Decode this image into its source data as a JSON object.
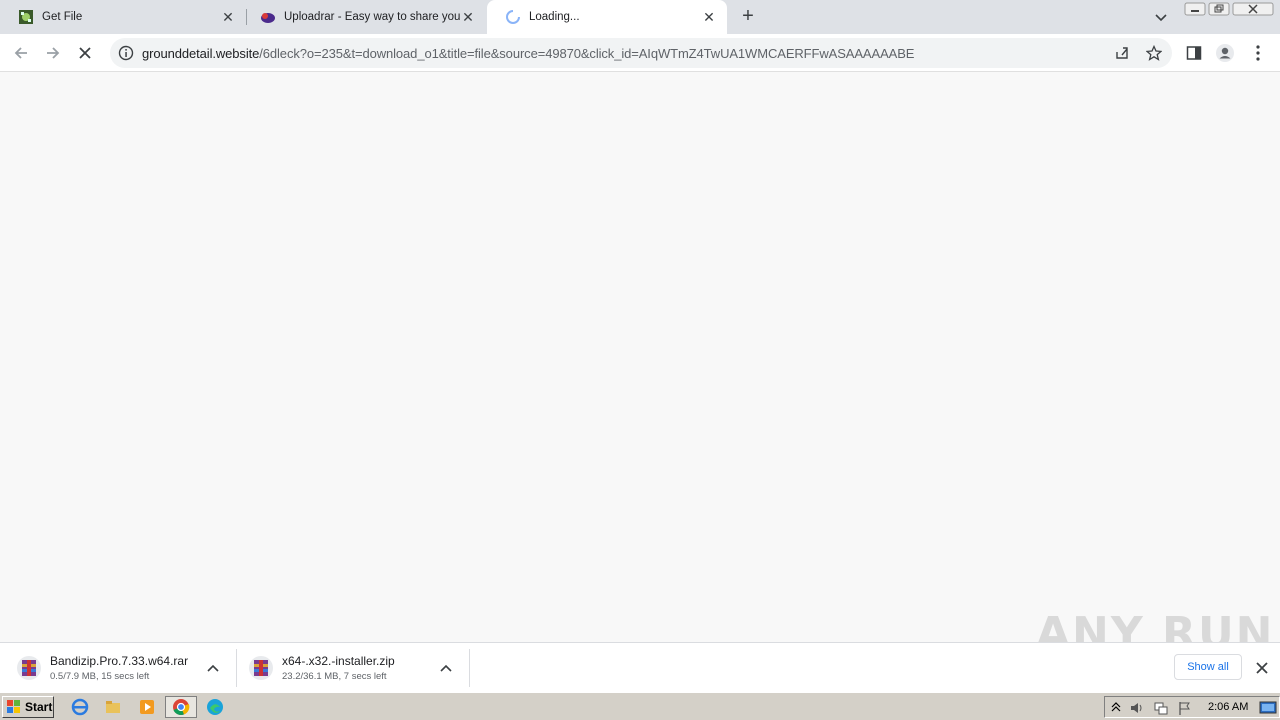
{
  "tabs": [
    {
      "title": "Get File",
      "favicon": "get-file-favicon"
    },
    {
      "title": "Uploadrar - Easy way to share your",
      "favicon": "uploadrar-favicon"
    },
    {
      "title": "Loading...",
      "favicon": "loading-spinner-icon"
    }
  ],
  "address_bar": {
    "host": "grounddetail.website",
    "path": "/6dleck?o=235&t=download_o1&title=file&source=49870&click_id=AIqWTmZ4TwUA1WMCAERFFwASAAAAAABE"
  },
  "downloads": [
    {
      "name": "Bandizip.Pro.7.33.w64.rar",
      "status": "0.5/7.9 MB, 15 secs left",
      "icon": "winrar-archive-icon"
    },
    {
      "name": "x64-.x32.-installer.zip",
      "status": "23.2/36.1 MB, 7 secs left",
      "icon": "winrar-archive-icon"
    }
  ],
  "show_all_label": "Show all",
  "watermark": "ANY RUN",
  "taskbar": {
    "start_label": "Start",
    "clock": "2:06 AM",
    "pinned": [
      "ie-icon",
      "folder-icon",
      "media-player-icon",
      "chrome-icon",
      "edge-icon"
    ]
  },
  "colors": {
    "accent": "#1a73e8",
    "tabstrip": "#dee1e6",
    "taskbar": "#d4d0c8"
  }
}
